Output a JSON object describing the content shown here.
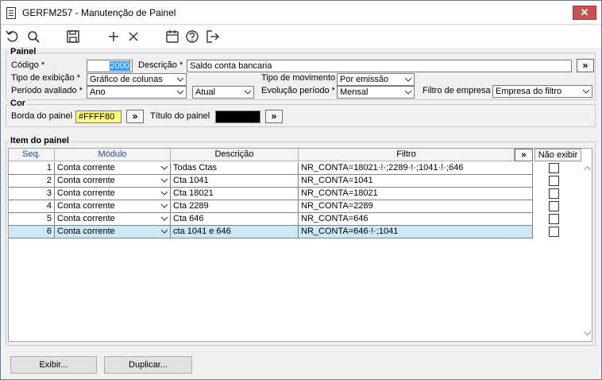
{
  "window": {
    "title": "GERFM257 - Manutenção de Painel",
    "close_label": "✕"
  },
  "toolbar": {
    "icons": [
      "undo-icon",
      "search-icon",
      "save-icon",
      "add-icon",
      "delete-icon",
      "calendar-icon",
      "help-icon",
      "exit-icon"
    ]
  },
  "painel": {
    "title": "Painel",
    "codigo_label": "Código *",
    "codigo_value": "2000",
    "descricao_label": "Descrição *",
    "descricao_value": "Saldo conta bancaria",
    "tipo_exibicao_label": "Tipo de exibição *",
    "tipo_exibicao_value": "Gráfico de colunas",
    "tipo_movimento_label": "Tipo de movimento",
    "tipo_movimento_value": "Por emissão",
    "periodo_label": "Período avaliado *",
    "periodo_value": "Ano",
    "periodo_ref_value": "Atual",
    "evolucao_label": "Evolução período *",
    "evolucao_value": "Mensal",
    "filtro_empresa_label": "Filtro de empresa",
    "filtro_empresa_value": "Empresa do filtro",
    "more_label": "»"
  },
  "cor": {
    "title": "Cor",
    "borda_label": "Borda do painel",
    "borda_value": "#FFFF80",
    "titulo_label": "Título do painel",
    "more_label": "»",
    "borda_color": "#FFFF80",
    "titulo_color": "#000000"
  },
  "itens": {
    "title": "Item do painel",
    "headers": {
      "seq": "Seq.",
      "modulo": "Módulo",
      "descricao": "Descrição",
      "filtro": "Filtro",
      "more": "»",
      "nao_exibir": "Não exibir"
    },
    "rows": [
      {
        "seq": "1",
        "modulo": "Conta corrente",
        "descricao": "Todas Ctas",
        "filtro": "NR_CONTA=18021·!·;2289·!·;1041·!·;646"
      },
      {
        "seq": "2",
        "modulo": "Conta corrente",
        "descricao": "Cta 1041",
        "filtro": "NR_CONTA=1041"
      },
      {
        "seq": "3",
        "modulo": "Conta corrente",
        "descricao": "Cta 18021",
        "filtro": "NR_CONTA=18021"
      },
      {
        "seq": "4",
        "modulo": "Conta corrente",
        "descricao": "Cta 2289",
        "filtro": "NR_CONTA=2289"
      },
      {
        "seq": "5",
        "modulo": "Conta corrente",
        "descricao": "Cta 646",
        "filtro": "NR_CONTA=646"
      },
      {
        "seq": "6",
        "modulo": "Conta corrente",
        "descricao": "cta 1041 e  646",
        "filtro": "NR_CONTA=646·!·;1041"
      }
    ]
  },
  "buttons": {
    "exibir": "Exibir...",
    "duplicar": "Duplicar..."
  }
}
